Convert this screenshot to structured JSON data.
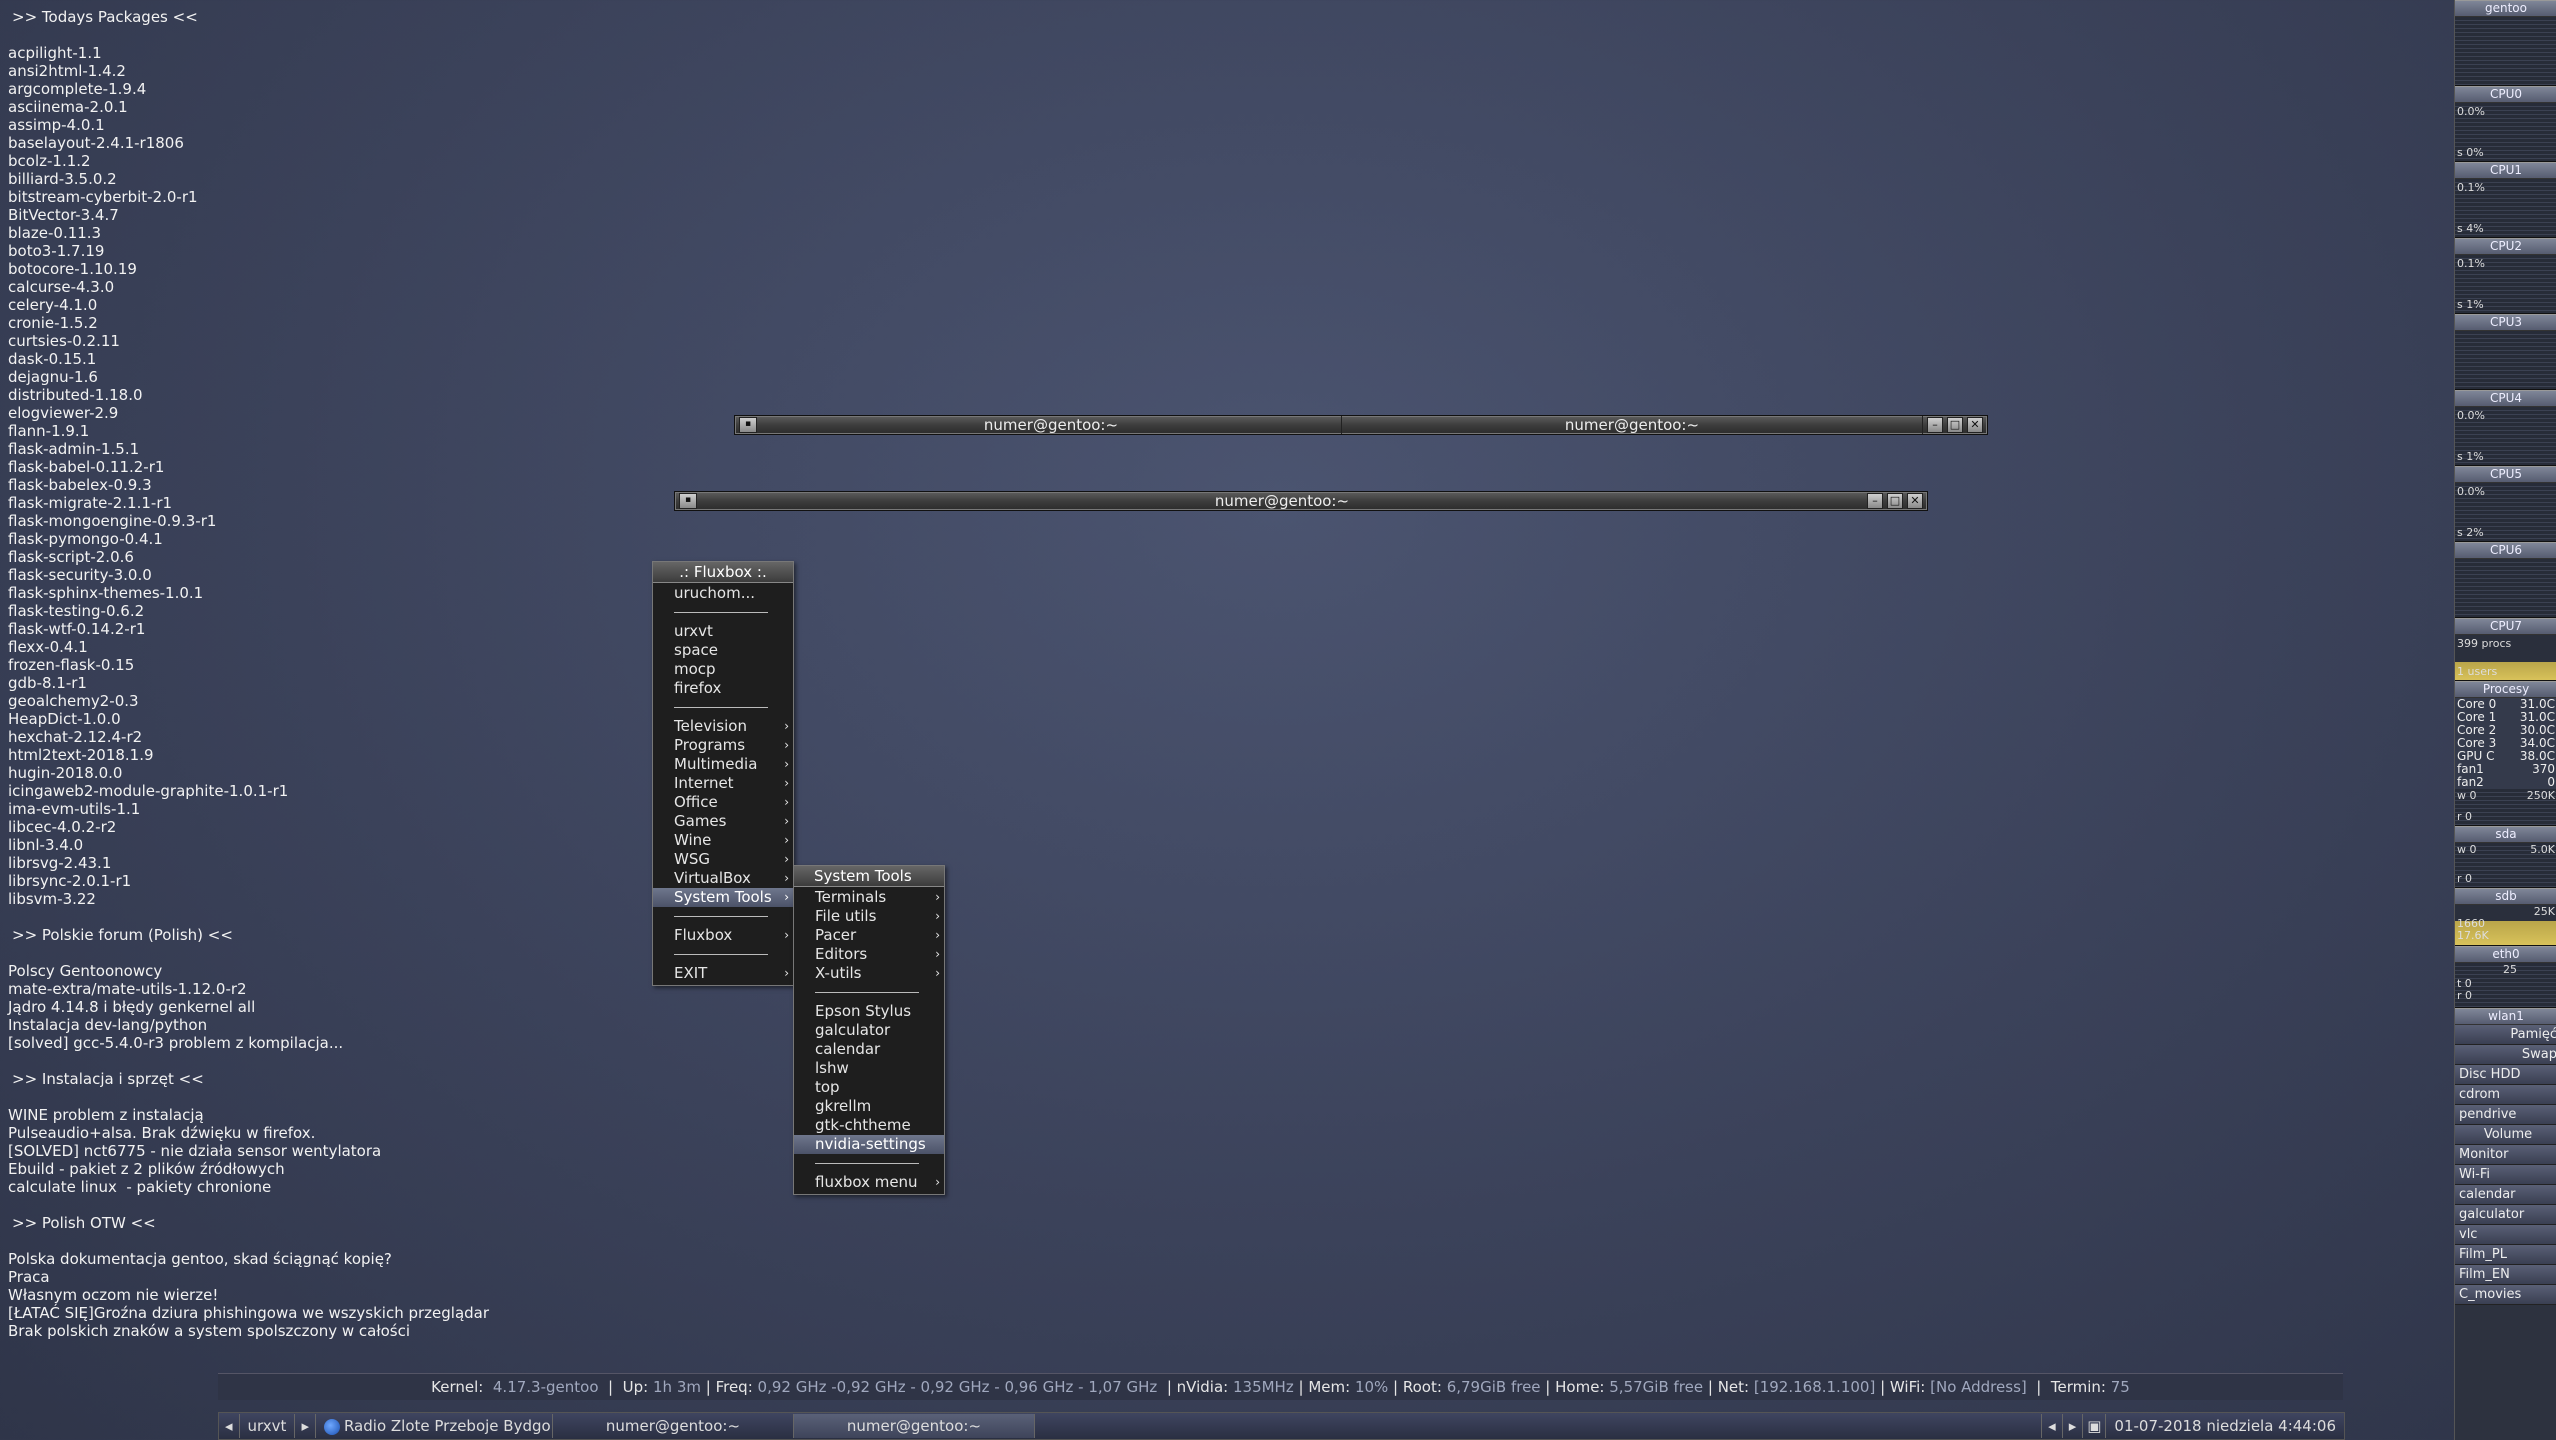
{
  "desktop": {
    "sections": [
      {
        "header": ">> Todays Packages <<",
        "lines": [
          "acpilight-1.1",
          "ansi2html-1.4.2",
          "argcomplete-1.9.4",
          "asciinema-2.0.1",
          "assimp-4.0.1",
          "baselayout-2.4.1-r1806",
          "bcolz-1.1.2",
          "billiard-3.5.0.2",
          "bitstream-cyberbit-2.0-r1",
          "BitVector-3.4.7",
          "blaze-0.11.3",
          "boto3-1.7.19",
          "botocore-1.10.19",
          "calcurse-4.3.0",
          "celery-4.1.0",
          "cronie-1.5.2",
          "curtsies-0.2.11",
          "dask-0.15.1",
          "dejagnu-1.6",
          "distributed-1.18.0",
          "elogviewer-2.9",
          "flann-1.9.1",
          "flask-admin-1.5.1",
          "flask-babel-0.11.2-r1",
          "flask-babelex-0.9.3",
          "flask-migrate-2.1.1-r1",
          "flask-mongoengine-0.9.3-r1",
          "flask-pymongo-0.4.1",
          "flask-script-2.0.6",
          "flask-security-3.0.0",
          "flask-sphinx-themes-1.0.1",
          "flask-testing-0.6.2",
          "flask-wtf-0.14.2-r1",
          "flexx-0.4.1",
          "frozen-flask-0.15",
          "gdb-8.1-r1",
          "geoalchemy2-0.3",
          "HeapDict-1.0.0",
          "hexchat-2.12.4-r2",
          "html2text-2018.1.9",
          "hugin-2018.0.0",
          "icingaweb2-module-graphite-1.0.1-r1",
          "ima-evm-utils-1.1",
          "libcec-4.0.2-r2",
          "libnl-3.4.0",
          "librsvg-2.43.1",
          "librsync-2.0.1-r1",
          "libsvm-3.22"
        ]
      },
      {
        "header": ">> Polskie forum (Polish) <<",
        "lines": [
          "Polscy Gentoonowcy",
          "mate-extra/mate-utils-1.12.0-r2",
          "Jądro 4.14.8 i błędy genkernel all",
          "Instalacja dev-lang/python",
          "[solved] gcc-5.4.0-r3 problem z kompilacja..."
        ]
      },
      {
        "header": ">> Instalacja i sprzęt <<",
        "lines": [
          "WINE problem z instalacją",
          "Pulseaudio+alsa. Brak dźwięku w firefox.",
          "[SOLVED] nct6775 - nie działa sensor wentylatora",
          "Ebuild - pakiet z 2 plików źródłowych",
          "calculate linux  - pakiety chronione"
        ]
      },
      {
        "header": ">> Polish OTW <<",
        "lines": [
          "Polska dokumentacja gentoo, skad ściągnąć kopię?",
          "Praca",
          "Własnym oczom nie wierze!",
          "[ŁATAĆ SIĘ]Groźna dziura phishingowa we wszyskich przeglądar",
          "Brak polskich znaków a system spolszczony w całości"
        ]
      }
    ]
  },
  "windows": {
    "tabbed": {
      "tab1": "numer@gentoo:~",
      "tab2": "numer@gentoo:~"
    },
    "single": {
      "title": "numer@gentoo:~"
    }
  },
  "root_menu": {
    "title": ".: Fluxbox :.",
    "items": [
      {
        "label": "uruchom..."
      },
      {
        "sep": true
      },
      {
        "label": "urxvt"
      },
      {
        "label": "space"
      },
      {
        "label": "mocp"
      },
      {
        "label": "firefox"
      },
      {
        "sep": true
      },
      {
        "label": "Television",
        "sub": true
      },
      {
        "label": "Programs",
        "sub": true
      },
      {
        "label": "Multimedia",
        "sub": true
      },
      {
        "label": "Internet",
        "sub": true
      },
      {
        "label": "Office",
        "sub": true
      },
      {
        "label": "Games",
        "sub": true
      },
      {
        "label": "Wine",
        "sub": true
      },
      {
        "label": "WSG",
        "sub": true
      },
      {
        "label": "VirtualBox",
        "sub": true
      },
      {
        "label": "System Tools",
        "sub": true,
        "active": true
      },
      {
        "sep": true
      },
      {
        "label": "Fluxbox",
        "sub": true
      },
      {
        "sep": true
      },
      {
        "label": "EXIT",
        "sub": true
      }
    ]
  },
  "system_tools_menu": {
    "title": "System Tools",
    "items": [
      {
        "label": "Terminals",
        "sub": true
      },
      {
        "label": "File utils",
        "sub": true
      },
      {
        "label": "Pacer",
        "sub": true
      },
      {
        "label": "Editors",
        "sub": true
      },
      {
        "label": "X-utils",
        "sub": true
      },
      {
        "sep": true
      },
      {
        "label": "Epson Stylus"
      },
      {
        "label": "galculator"
      },
      {
        "label": "calendar"
      },
      {
        "label": "lshw"
      },
      {
        "label": "top"
      },
      {
        "label": "gkrellm"
      },
      {
        "label": "gtk-chtheme"
      },
      {
        "label": "nvidia-settings",
        "active": true
      },
      {
        "sep": true
      },
      {
        "label": "fluxbox menu",
        "sub": true
      }
    ]
  },
  "status": {
    "kernel_label": "Kernel:",
    "kernel": "4.17.3-gentoo",
    "up_label": "Up:",
    "up": "1h 3m",
    "freq_label": "Freq:",
    "freq": "0,92 GHz -0,92 GHz - 0,92 GHz - 0,96 GHz - 1,07 GHz",
    "nvidia_label": "nVidia:",
    "nvidia": "135MHz",
    "mem_label": "Mem:",
    "mem": "10%",
    "root_label": "Root:",
    "root": "6,79GiB free",
    "home_label": "Home:",
    "home": "5,57GiB free",
    "net_label": "Net:",
    "net": "[192.168.1.100]",
    "wifi_label": "WiFi:",
    "wifi": "[No Address]",
    "termin_label": "Termin:",
    "termin": "75"
  },
  "toolbar": {
    "workspace": "urxvt",
    "tasks": [
      "Radio Zlote Przeboje Bydgo",
      "numer@gentoo:~",
      "numer@gentoo:~"
    ],
    "clock": "01-07-2018 niedziela   4:44:06"
  },
  "gkrellm": {
    "host": "gentoo",
    "cpus": [
      {
        "name": "CPU0",
        "top": "0.0%",
        "bot": "s 0%"
      },
      {
        "name": "CPU1",
        "top": "0.1%",
        "bot": "s 4%"
      },
      {
        "name": "CPU2",
        "top": "0.1%",
        "bot": "s 1%"
      },
      {
        "name": "CPU3",
        "top": "",
        "bot": ""
      },
      {
        "name": "CPU4",
        "top": "0.0%",
        "bot": "s 1%"
      },
      {
        "name": "CPU5",
        "top": "0.0%",
        "bot": "s 2%"
      },
      {
        "name": "CPU6",
        "top": "",
        "bot": ""
      },
      {
        "name": "CPU7",
        "top": "399 procs",
        "bot": "1 users"
      }
    ],
    "procesy": "Procesy",
    "sensors": [
      [
        "Core 0",
        "31.0C"
      ],
      [
        "Core 1",
        "31.0C"
      ],
      [
        "Core 2",
        "30.0C"
      ],
      [
        "Core 3",
        "34.0C"
      ],
      [
        "GPU C",
        "38.0C"
      ],
      [
        "fan1",
        "370"
      ],
      [
        "fan2",
        "0"
      ]
    ],
    "disk1": {
      "w": "w 0",
      "wval": "250K",
      "r": "r 0"
    },
    "sda": {
      "name": "sda",
      "w": "w 0",
      "wval": "5.0K",
      "r": "r 0"
    },
    "sdb": {
      "name": "sdb",
      "val": "25K",
      "l1": "1660",
      "l2": "17.6K"
    },
    "eth0": {
      "name": "eth0",
      "val": "25",
      "t": "t 0",
      "r": "r 0"
    },
    "wlan1": "wlan1",
    "buttons": [
      "Pamięć",
      "Swap",
      "Disc HDD",
      "cdrom",
      "pendrive",
      "Volume",
      "Monitor",
      "Wi-Fi",
      "calendar",
      "galculator",
      "vlc",
      "Film_PL",
      "Film_EN",
      "C_movies"
    ]
  }
}
